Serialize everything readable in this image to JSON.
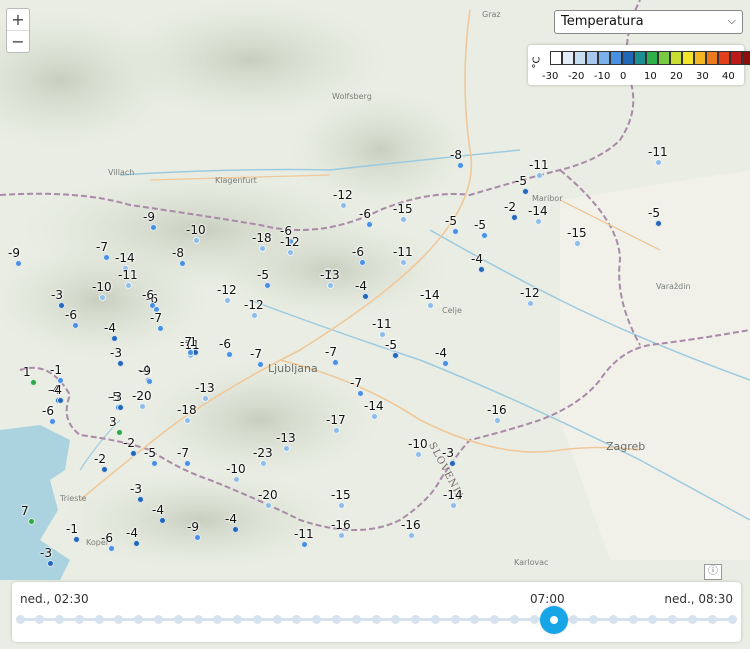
{
  "zoom": {
    "in_label": "+",
    "out_label": "−"
  },
  "parameter_select": {
    "selected": "Temperatura"
  },
  "legend": {
    "unit": "°C",
    "colors": [
      "#ffffff",
      "#e4ecf8",
      "#c8dcf2",
      "#a8c8ee",
      "#7bb1ea",
      "#4a90e2",
      "#2367b8",
      "#1b8f8f",
      "#2fb04a",
      "#7ac943",
      "#c8de2e",
      "#f5e52a",
      "#f5b623",
      "#ee7a1e",
      "#e1401a",
      "#bc1a1a",
      "#8a0f0f"
    ],
    "ticks": [
      "-30",
      "-20",
      "-10",
      "0",
      "10",
      "20",
      "30",
      "40"
    ]
  },
  "places": [
    {
      "name": "Graz"
    },
    {
      "name": "Villach"
    },
    {
      "name": "Klagenfurt"
    },
    {
      "name": "Wolfsberg"
    },
    {
      "name": "Ljubljana"
    },
    {
      "name": "Celje"
    },
    {
      "name": "Maribor"
    },
    {
      "name": "Zagreb"
    },
    {
      "name": "Trieste"
    },
    {
      "name": "Varaždin"
    },
    {
      "name": "Koper"
    },
    {
      "name": "Karlovac"
    }
  ],
  "country_label": "SLOVENIA",
  "station_colors": {
    "cold": "#4a90e2",
    "mid": "#2367b8",
    "dark": "#1f5fa8",
    "pale": "#8fbde9",
    "warm": "#2fa84a"
  },
  "stations": [
    {
      "v": "-8",
      "c": "cold"
    },
    {
      "v": "-11",
      "c": "pale"
    },
    {
      "v": "-5",
      "c": "mid"
    },
    {
      "v": "-11",
      "c": "pale"
    },
    {
      "v": "-2",
      "c": "mid"
    },
    {
      "v": "-14",
      "c": "pale"
    },
    {
      "v": "-5",
      "c": "mid"
    },
    {
      "v": "-15",
      "c": "pale"
    },
    {
      "v": "-12",
      "c": "pale"
    },
    {
      "v": "-6",
      "c": "cold"
    },
    {
      "v": "-15",
      "c": "pale"
    },
    {
      "v": "-5",
      "c": "cold"
    },
    {
      "v": "-5",
      "c": "cold"
    },
    {
      "v": "-4",
      "c": "mid"
    },
    {
      "v": "-11",
      "c": "pale"
    },
    {
      "v": "-14",
      "c": "pale"
    },
    {
      "v": "-5",
      "c": "mid"
    },
    {
      "v": "-9",
      "c": "cold"
    },
    {
      "v": "-10",
      "c": "pale"
    },
    {
      "v": "-9",
      "c": "cold"
    },
    {
      "v": "-7",
      "c": "cold"
    },
    {
      "v": "-14",
      "c": "pale"
    },
    {
      "v": "-8",
      "c": "cold"
    },
    {
      "v": "-18",
      "c": "pale"
    },
    {
      "v": "-6",
      "c": "cold"
    },
    {
      "v": "-12",
      "c": "pale"
    },
    {
      "v": "-6",
      "c": "cold"
    },
    {
      "v": "-7",
      "c": "cold"
    },
    {
      "v": "-4",
      "c": "mid"
    },
    {
      "v": "-11",
      "c": "pale"
    },
    {
      "v": "-5",
      "c": "cold"
    },
    {
      "v": "-13",
      "c": "pale"
    },
    {
      "v": "-6",
      "c": "cold"
    },
    {
      "v": "-6",
      "c": "cold"
    },
    {
      "v": "-3",
      "c": "mid"
    },
    {
      "v": "-10",
      "c": "pale"
    },
    {
      "v": "-6",
      "c": "cold"
    },
    {
      "v": "-12",
      "c": "pale"
    },
    {
      "v": "-12",
      "c": "pale"
    },
    {
      "v": "-14",
      "c": "pale"
    },
    {
      "v": "-12",
      "c": "pale"
    },
    {
      "v": "-6",
      "c": "cold"
    },
    {
      "v": "-4",
      "c": "cold"
    },
    {
      "v": "-7",
      "c": "cold"
    },
    {
      "v": "-7",
      "c": "cold"
    },
    {
      "v": "-11",
      "c": "pale"
    },
    {
      "v": "-1",
      "c": "mid"
    },
    {
      "v": "-4",
      "c": "mid"
    },
    {
      "v": "-11",
      "c": "pale"
    },
    {
      "v": "-4",
      "c": "mid"
    },
    {
      "v": "-6",
      "c": "cold"
    },
    {
      "v": "-5",
      "c": "cold"
    },
    {
      "v": "-4",
      "c": "mid"
    },
    {
      "v": "-3",
      "c": "mid"
    },
    {
      "v": "-7",
      "c": "cold"
    },
    {
      "v": "-7",
      "c": "cold"
    },
    {
      "v": "-9",
      "c": "cold"
    },
    {
      "v": "1",
      "c": "warm"
    },
    {
      "v": "-4",
      "c": "mid"
    },
    {
      "v": "-13",
      "c": "pale"
    },
    {
      "v": "-7",
      "c": "cold"
    },
    {
      "v": "-3",
      "c": "mid"
    },
    {
      "v": "-20",
      "c": "pale"
    },
    {
      "v": "-6",
      "c": "cold"
    },
    {
      "v": "-18",
      "c": "pale"
    },
    {
      "v": "-14",
      "c": "pale"
    },
    {
      "v": "3",
      "c": "warm"
    },
    {
      "v": "-17",
      "c": "pale"
    },
    {
      "v": "-16",
      "c": "pale"
    },
    {
      "v": "-13",
      "c": "pale"
    },
    {
      "v": "-2",
      "c": "mid"
    },
    {
      "v": "-5",
      "c": "cold"
    },
    {
      "v": "-7",
      "c": "cold"
    },
    {
      "v": "-23",
      "c": "pale"
    },
    {
      "v": "-10",
      "c": "pale"
    },
    {
      "v": "-2",
      "c": "mid"
    },
    {
      "v": "-10",
      "c": "pale"
    },
    {
      "v": "-3",
      "c": "mid"
    },
    {
      "v": "-3",
      "c": "mid"
    },
    {
      "v": "-20",
      "c": "pale"
    },
    {
      "v": "-15",
      "c": "pale"
    },
    {
      "v": "-14",
      "c": "pale"
    },
    {
      "v": "7",
      "c": "warm"
    },
    {
      "v": "-4",
      "c": "mid"
    },
    {
      "v": "-1",
      "c": "mid"
    },
    {
      "v": "-4",
      "c": "mid"
    },
    {
      "v": "-9",
      "c": "cold"
    },
    {
      "v": "-16",
      "c": "pale"
    },
    {
      "v": "-16",
      "c": "pale"
    },
    {
      "v": "-6",
      "c": "cold"
    },
    {
      "v": "-4",
      "c": "mid"
    },
    {
      "v": "-11",
      "c": "cold"
    },
    {
      "v": "-3",
      "c": "mid"
    },
    {
      "v": "-1",
      "c": "cold"
    },
    {
      "v": "-5",
      "c": "mid"
    },
    {
      "v": "-7",
      "c": "cold"
    }
  ],
  "timeline": {
    "start_label": "ned., 02:30",
    "current_label": "07:00",
    "end_label": "ned., 08:30",
    "steps": 37,
    "current_index": 27
  },
  "attribution_icon": "info-icon"
}
